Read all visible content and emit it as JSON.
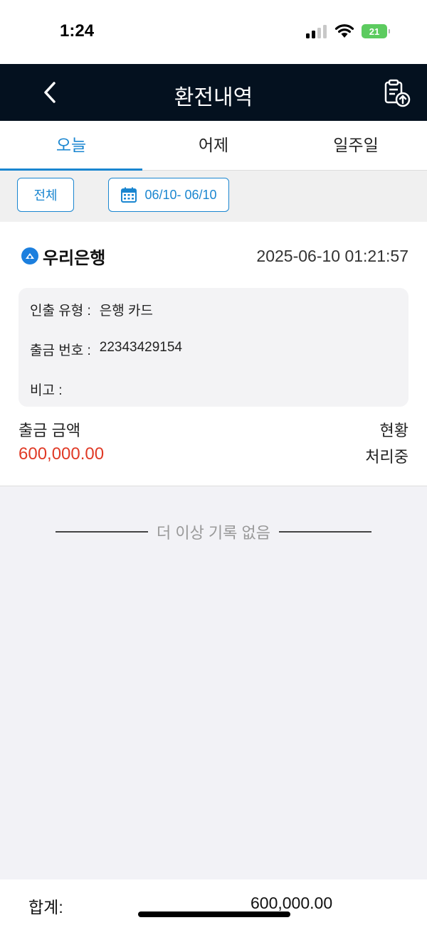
{
  "status_bar": {
    "time": "1:24",
    "battery": "21"
  },
  "navbar": {
    "title": "환전내역"
  },
  "tabs": [
    {
      "label": "오늘",
      "active": true
    },
    {
      "label": "어제",
      "active": false
    },
    {
      "label": "일주일",
      "active": false
    }
  ],
  "filters": {
    "all_label": "전체",
    "date_range": "06/10- 06/10"
  },
  "record": {
    "bank_name": "우리은행",
    "datetime": "2025-06-10 01:21:57",
    "details": [
      {
        "label": "인출 유형 :",
        "value": "은행 카드"
      },
      {
        "label": "출금 번호 :",
        "value": "22343429154"
      },
      {
        "label": "비고 :",
        "value": ""
      }
    ],
    "amount_label": "출금 금액",
    "amount": "600,000.00",
    "status_label": "현황",
    "status": "처리중"
  },
  "end_note": "더 이상 기록 없음",
  "footer": {
    "total_label": "합계:",
    "total_value": "600,000.00"
  },
  "colors": {
    "accent": "#1a86d0",
    "navbar": "#04111f",
    "amount": "#e03a26",
    "battery": "#5ccb5f"
  }
}
